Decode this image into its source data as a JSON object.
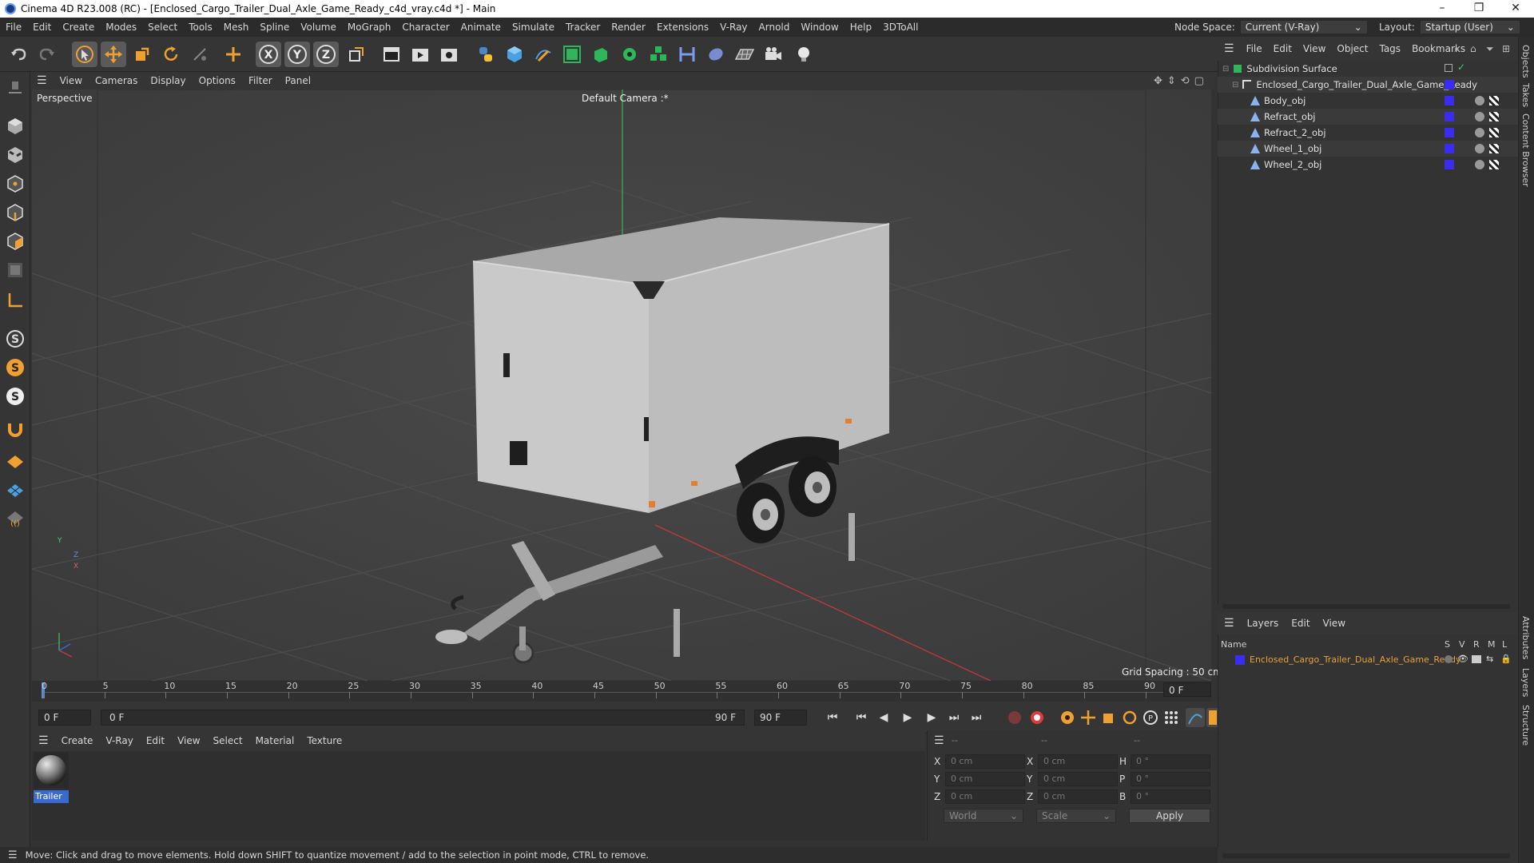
{
  "window": {
    "title": "Cinema 4D R23.008 (RC) - [Enclosed_Cargo_Trailer_Dual_Axle_Game_Ready_c4d_vray.c4d *] - Main",
    "controls": [
      "–",
      "❐",
      "✕"
    ]
  },
  "menubar": {
    "items": [
      "File",
      "Edit",
      "Create",
      "Modes",
      "Select",
      "Tools",
      "Mesh",
      "Spline",
      "Volume",
      "MoGraph",
      "Character",
      "Animate",
      "Simulate",
      "Tracker",
      "Render",
      "Extensions",
      "V-Ray",
      "Arnold",
      "Window",
      "Help",
      "3DToAll"
    ],
    "node_space_label": "Node Space:",
    "node_space_value": "Current (V-Ray)",
    "layout_label": "Layout:",
    "layout_value": "Startup (User)"
  },
  "viewport": {
    "menu": [
      "View",
      "Cameras",
      "Display",
      "Options",
      "Filter",
      "Panel"
    ],
    "label": "Perspective",
    "camera": "Default Camera :*",
    "grid_spacing": "Grid Spacing : 50 cm",
    "axis": {
      "y": "Y",
      "z": "Z",
      "x": "X"
    }
  },
  "timeline": {
    "ticks": [
      "0",
      "5",
      "10",
      "15",
      "20",
      "25",
      "30",
      "35",
      "40",
      "45",
      "50",
      "55",
      "60",
      "65",
      "70",
      "75",
      "80",
      "85",
      "90"
    ],
    "current_frame_right": "0 F",
    "start_field": "0 F",
    "range_start": "0 F",
    "range_end": "90 F",
    "end_field": "90 F"
  },
  "material_manager": {
    "menu": [
      "Create",
      "V-Ray",
      "Edit",
      "View",
      "Select",
      "Material",
      "Texture"
    ],
    "materials": [
      {
        "name": "Trailer"
      }
    ]
  },
  "coordinates": {
    "header_dashes": [
      "--",
      "--",
      "--"
    ],
    "rows": [
      {
        "a": "X",
        "av": "0 cm",
        "b": "X",
        "bv": "0 cm",
        "c": "H",
        "cv": "0 °"
      },
      {
        "a": "Y",
        "av": "0 cm",
        "b": "Y",
        "bv": "0 cm",
        "c": "P",
        "cv": "0 °"
      },
      {
        "a": "Z",
        "av": "0 cm",
        "b": "Z",
        "bv": "0 cm",
        "c": "B",
        "cv": "0 °"
      }
    ],
    "world": "World",
    "scale": "Scale",
    "apply": "Apply"
  },
  "object_manager": {
    "menu": [
      "File",
      "Edit",
      "View",
      "Object",
      "Tags",
      "Bookmarks"
    ],
    "objects": [
      {
        "name": "Subdivision Surface",
        "indent": 0
      },
      {
        "name": "Enclosed_Cargo_Trailer_Dual_Axle_Game_Ready",
        "indent": 1
      },
      {
        "name": "Body_obj",
        "indent": 2
      },
      {
        "name": "Refract_obj",
        "indent": 2
      },
      {
        "name": "Refract_2_obj",
        "indent": 2
      },
      {
        "name": "Wheel_1_obj",
        "indent": 2
      },
      {
        "name": "Wheel_2_obj",
        "indent": 2
      }
    ]
  },
  "layers": {
    "menu": [
      "Layers",
      "Edit",
      "View"
    ],
    "col_name": "Name",
    "cols": [
      "S",
      "V",
      "R",
      "M",
      "L"
    ],
    "items": [
      {
        "name": "Enclosed_Cargo_Trailer_Dual_Axle_Game_Ready",
        "color": "#3a2df0"
      }
    ]
  },
  "right_tabs": [
    "Objects",
    "Takes",
    "Content Browser",
    "Attributes",
    "Layers",
    "Structure"
  ],
  "status": "Move: Click and drag to move elements. Hold down SHIFT to quantize movement / add to the selection in point mode, CTRL to remove.",
  "colors": {
    "accent": "#5a8fd8",
    "layer": "#3a2df0",
    "record": "#e03a3a",
    "layer_text": "#e8a23a"
  }
}
